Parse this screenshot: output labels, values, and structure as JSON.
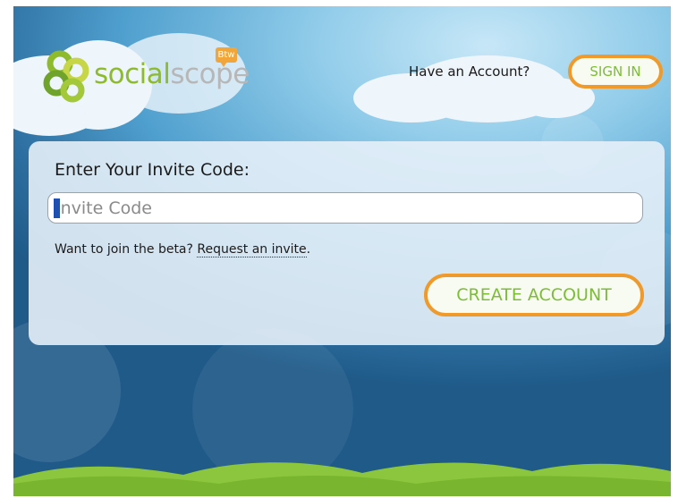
{
  "logo": {
    "word_part1": "social",
    "word_part2": "scope",
    "badge": "Btw",
    "mark_icon": "flower-logo-icon"
  },
  "header": {
    "account_prompt": "Have an Account?",
    "signin_label": "SIGN IN"
  },
  "invite": {
    "label": "Enter Your Invite Code:",
    "input_value": "",
    "placeholder": "Invite Code"
  },
  "beta": {
    "prompt": "Want to join the beta?",
    "link_label": "Request an invite",
    "suffix": "."
  },
  "actions": {
    "create_account_label": "CREATE ACCOUNT"
  },
  "colors": {
    "accent_orange": "#ef9a2b",
    "accent_green": "#7dbd36",
    "sky_blue": "#8fcbe9",
    "grass_green": "#8cc63e"
  }
}
